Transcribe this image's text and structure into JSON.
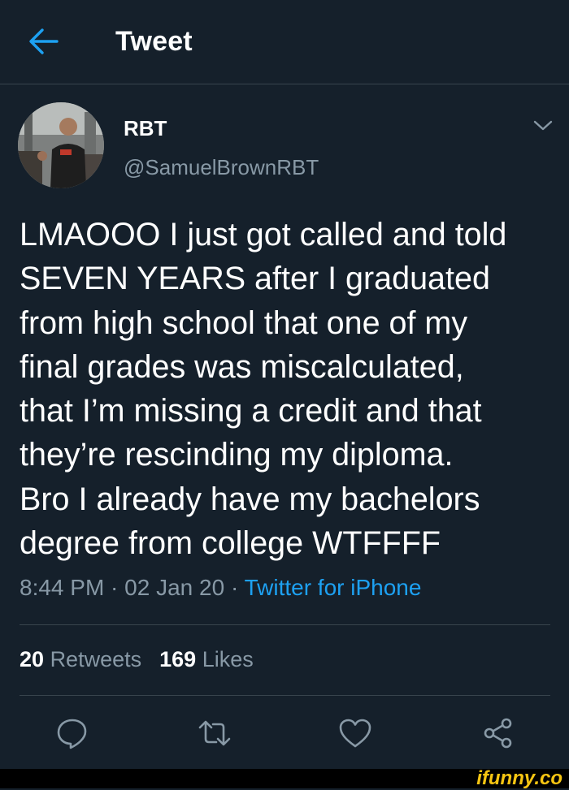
{
  "header": {
    "title": "Tweet",
    "back_icon": "arrow-left-icon"
  },
  "tweet": {
    "author": {
      "display_name": "RBT",
      "handle": "@SamuelBrownRBT"
    },
    "text": "LMAOOO I just got called and told\nSEVEN YEARS after I graduated\nfrom high school that one of my\nfinal grades was miscalculated,\nthat I’m missing a credit and that\nthey’re rescinding my diploma.\nBro I already have my bachelors\ndegree from college WTFFFF",
    "time": "8:44 PM",
    "date": "02 Jan 20",
    "source": "Twitter for iPhone",
    "separator": " · ",
    "stats": {
      "retweets_count": "20",
      "retweets_label": "Retweets",
      "likes_count": "169",
      "likes_label": "Likes"
    },
    "actions": [
      "reply-icon",
      "retweet-icon",
      "like-icon",
      "share-icon"
    ]
  },
  "watermark": "ifunny.co",
  "colors": {
    "background": "#15202b",
    "text": "#ffffff",
    "secondary": "#8899a6",
    "accent": "#1da1f2",
    "divider": "#38444d",
    "watermark": "#f6c512"
  }
}
